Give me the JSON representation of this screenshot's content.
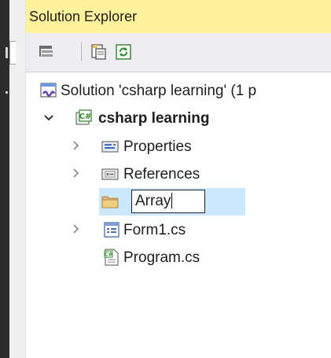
{
  "panel": {
    "title": "Solution Explorer"
  },
  "toolbar": {
    "buttons": [
      {
        "name": "collapse-all-icon"
      },
      {
        "name": "properties-icon"
      },
      {
        "name": "refresh-icon"
      }
    ]
  },
  "tree": {
    "solution_label": "Solution 'csharp learning' (1 p",
    "project_label": "csharp learning",
    "items": [
      {
        "label": "Properties",
        "icon": "properties-folder-icon",
        "expandable": true
      },
      {
        "label": "References",
        "icon": "references-icon",
        "expandable": true
      },
      {
        "label": "Array",
        "icon": "folder-icon",
        "expandable": false,
        "editing": true
      },
      {
        "label": "Form1.cs",
        "icon": "form-icon",
        "expandable": true
      },
      {
        "label": "Program.cs",
        "icon": "csharp-file-icon",
        "expandable": false
      }
    ]
  },
  "colors": {
    "title_bar": "#fff29d",
    "selection": "#cce8ff",
    "toolbar": "#eeeef2"
  }
}
